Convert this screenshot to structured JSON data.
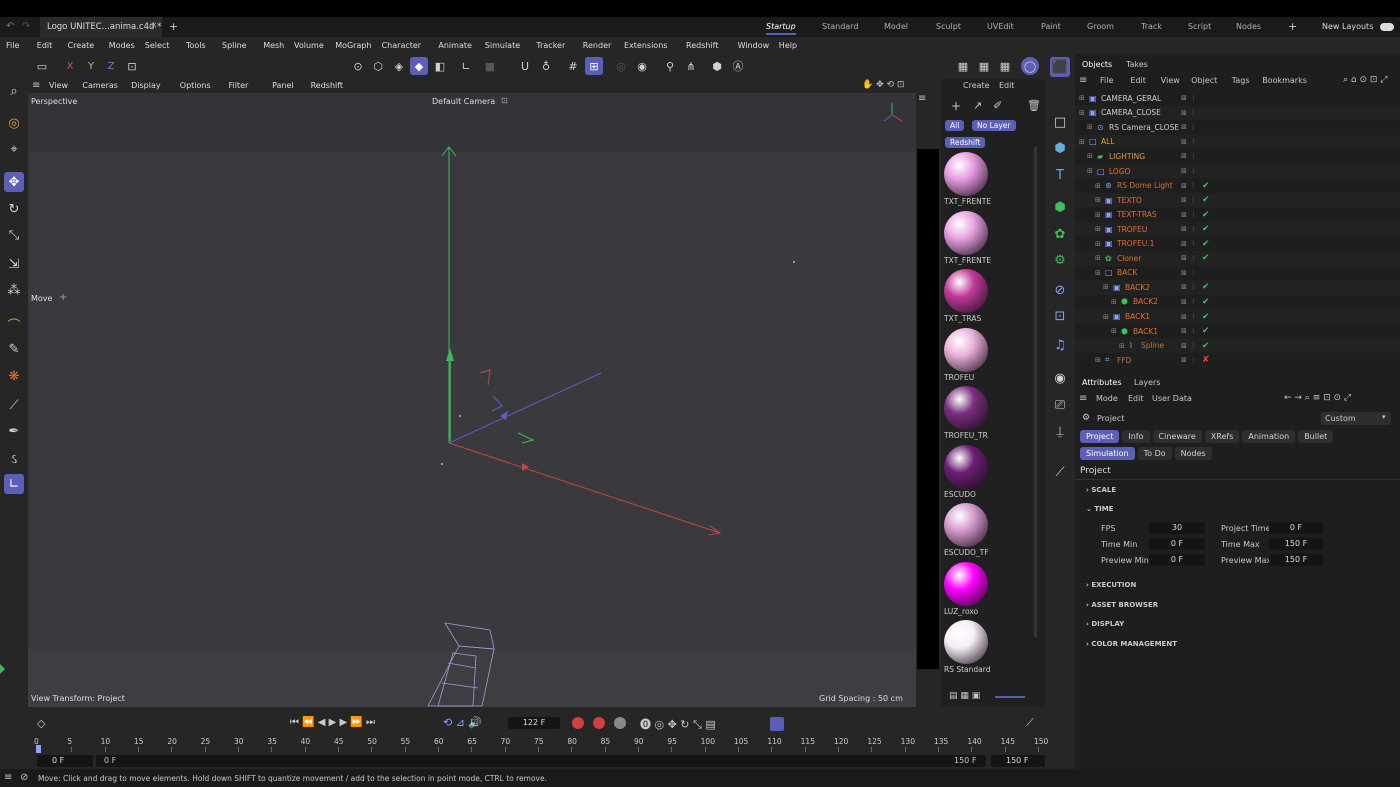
{
  "window": {
    "tab": "Logo UNITEC...anima.c4d *",
    "close": "×",
    "plus": "+"
  },
  "layouts": {
    "items": [
      "Startup",
      "Standard",
      "Model",
      "Sculpt",
      "UVEdit",
      "Paint",
      "Groom",
      "Track",
      "Script",
      "Nodes"
    ],
    "active": "Startup",
    "add": "+",
    "new_layouts": "New Layouts"
  },
  "menu": [
    "File",
    "Edit",
    "Create",
    "Modes",
    "Select",
    "Tools",
    "Spline",
    "Mesh",
    "Volume",
    "MoGraph",
    "Character",
    "Animate",
    "Simulate",
    "Tracker",
    "Render",
    "Extensions",
    "Redshift",
    "Window",
    "Help"
  ],
  "toolbar": {
    "x": "X",
    "y": "Y",
    "z": "Z"
  },
  "viewport": {
    "menu": [
      "View",
      "Cameras",
      "Display",
      "Options",
      "Filter",
      "Panel",
      "Redshift"
    ],
    "name": "Perspective",
    "camera": "Default Camera",
    "move_label": "Move",
    "view_transform": "View Transform: Project",
    "grid_spacing": "Grid Spacing : 50 cm"
  },
  "materials": {
    "menu": [
      "Create",
      "Edit"
    ],
    "filters": [
      "All",
      "No Layer"
    ],
    "renderer": "Redshift",
    "items": [
      {
        "name": "TXT_FRENTE",
        "color": "#e59be0"
      },
      {
        "name": "TXT_FRENTE",
        "color": "#e8a2e0"
      },
      {
        "name": "TXT_TRAS",
        "color": "#c13a9a"
      },
      {
        "name": "TROFEU",
        "color": "#e9b0d9"
      },
      {
        "name": "TROFEU_TR",
        "color": "#7a2f80"
      },
      {
        "name": "ESCUDO",
        "color": "#6b1f74"
      },
      {
        "name": "ESCUDO_TF",
        "color": "#d69bcd"
      },
      {
        "name": "LUZ_roxo",
        "color": "#ff00ff"
      },
      {
        "name": "RS Standard",
        "color": "#f6eef4"
      }
    ]
  },
  "objects": {
    "tabs": [
      "Objects",
      "Takes"
    ],
    "menu": [
      "File",
      "Edit",
      "View",
      "Object",
      "Tags",
      "Bookmarks"
    ],
    "rows": [
      {
        "name": "CAMERA_GERAL",
        "color": "#d0d0d0",
        "icon": "camera-icon",
        "indent": 0,
        "check": ""
      },
      {
        "name": "CAMERA_CLOSE",
        "color": "#d0d0d0",
        "icon": "camera-icon",
        "indent": 0,
        "check": ""
      },
      {
        "name": "RS Camera_CLOSE",
        "color": "#d0d0d0",
        "icon": "rs-camera-icon",
        "indent": 1,
        "check": ""
      },
      {
        "name": "ALL",
        "color": "#e0a030",
        "icon": "null-icon",
        "indent": 0,
        "check": ""
      },
      {
        "name": "LIGHTING",
        "color": "#e0a030",
        "icon": "folder-icon",
        "indent": 1,
        "check": ""
      },
      {
        "name": "LOGO",
        "color": "#e07030",
        "icon": "null-icon",
        "indent": 1,
        "check": ""
      },
      {
        "name": "RS Dome Light",
        "color": "#d07030",
        "icon": "light-icon",
        "indent": 2,
        "check": "✔"
      },
      {
        "name": "TEXTO",
        "color": "#e07030",
        "icon": "object-icon",
        "indent": 2,
        "check": "✔"
      },
      {
        "name": "TEXT-TRAS",
        "color": "#e07030",
        "icon": "object-icon",
        "indent": 2,
        "check": "✔"
      },
      {
        "name": "TROFEU",
        "color": "#e07030",
        "icon": "object-icon",
        "indent": 2,
        "check": "✔"
      },
      {
        "name": "TROFEU.1",
        "color": "#e07030",
        "icon": "object-icon",
        "indent": 2,
        "check": "✔"
      },
      {
        "name": "Cloner",
        "color": "#e07030",
        "icon": "cloner-icon",
        "indent": 2,
        "check": "✔"
      },
      {
        "name": "BACK",
        "color": "#e07030",
        "icon": "null-icon",
        "indent": 2,
        "check": ""
      },
      {
        "name": "BACK2",
        "color": "#e07030",
        "icon": "object-icon",
        "indent": 3,
        "check": "✔"
      },
      {
        "name": "BACK2",
        "color": "#e07030",
        "icon": "extrude-icon",
        "indent": 4,
        "check": "✔"
      },
      {
        "name": "BACK1",
        "color": "#e07030",
        "icon": "object-icon",
        "indent": 3,
        "check": "✔"
      },
      {
        "name": "BACK1",
        "color": "#e07030",
        "icon": "extrude-icon",
        "indent": 4,
        "check": "✔"
      },
      {
        "name": "Spline",
        "color": "#d07030",
        "icon": "spline-icon",
        "indent": 5,
        "check": "✔"
      },
      {
        "name": "FFD",
        "color": "#d07030",
        "icon": "ffd-icon",
        "indent": 2,
        "check": "✘"
      }
    ]
  },
  "attributes": {
    "tabs": [
      "Attributes",
      "Layers"
    ],
    "menu": [
      "Mode",
      "Edit",
      "User Data"
    ],
    "project": "Project",
    "preset": "Custom",
    "subtabs": [
      "Project",
      "Info",
      "Cineware",
      "XRefs",
      "Animation",
      "Bullet"
    ],
    "subtabs2": [
      "Simulation",
      "To Do",
      "Nodes"
    ],
    "section_title": "Project",
    "sections": [
      "SCALE",
      "TIME",
      "EXECUTION",
      "ASSET BROWSER",
      "DISPLAY",
      "COLOR MANAGEMENT"
    ],
    "time": {
      "fps_label": "FPS",
      "fps": "30",
      "project_time_label": "Project Time",
      "project_time": "0 F",
      "time_min_label": "Time Min",
      "time_min": "0 F",
      "time_max_label": "Time Max",
      "time_max": "150 F",
      "preview_min_label": "Preview Min",
      "preview_min": "0 F",
      "preview_max_label": "Preview Max",
      "preview_max": "150 F"
    }
  },
  "timeline": {
    "current_frame": "122 F",
    "ticks": [
      "0",
      "5",
      "10",
      "15",
      "20",
      "25",
      "30",
      "35",
      "40",
      "45",
      "50",
      "55",
      "60",
      "65",
      "70",
      "75",
      "80",
      "85",
      "90",
      "95",
      "100",
      "105",
      "110",
      "115",
      "120",
      "125",
      "130",
      "135",
      "140",
      "145",
      "150"
    ],
    "start": "0 F",
    "start2": "0 F",
    "end": "150 F",
    "end2": "150 F",
    "cursor_frame": 0
  },
  "status": {
    "text": "Move: Click and drag to move elements. Hold down SHIFT to quantize movement / add to the selection in point mode, CTRL to remove."
  }
}
